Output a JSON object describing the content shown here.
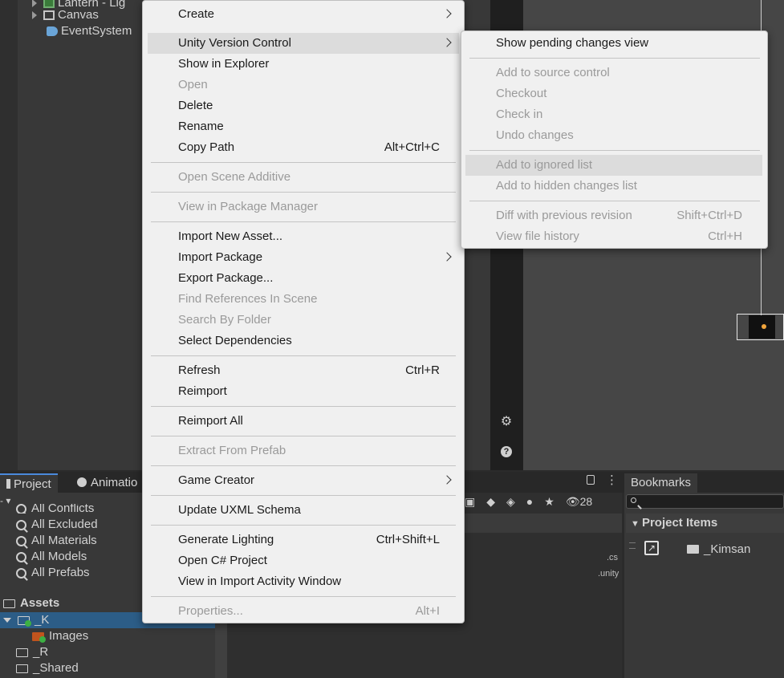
{
  "hierarchy": {
    "items": [
      {
        "label": "Lantern - Lig",
        "expandable": true
      },
      {
        "label": "Canvas",
        "expandable": true
      },
      {
        "label": "EventSystem",
        "expandable": false
      }
    ]
  },
  "context_menu": {
    "items": [
      {
        "label": "Create",
        "submenu": true
      },
      {
        "label": "Unity Version Control",
        "submenu": true,
        "highlighted": true
      },
      {
        "label": "Show in Explorer"
      },
      {
        "label": "Open",
        "disabled": true
      },
      {
        "label": "Delete"
      },
      {
        "label": "Rename"
      },
      {
        "label": "Copy Path",
        "shortcut": "Alt+Ctrl+C"
      },
      {
        "label": "Open Scene Additive",
        "disabled": true
      },
      {
        "label": "View in Package Manager",
        "disabled": true
      },
      {
        "label": "Import New Asset..."
      },
      {
        "label": "Import Package",
        "submenu": true
      },
      {
        "label": "Export Package..."
      },
      {
        "label": "Find References In Scene",
        "disabled": true
      },
      {
        "label": "Search By Folder",
        "disabled": true
      },
      {
        "label": "Select Dependencies"
      },
      {
        "label": "Refresh",
        "shortcut": "Ctrl+R"
      },
      {
        "label": "Reimport"
      },
      {
        "label": "Reimport All"
      },
      {
        "label": "Extract From Prefab",
        "disabled": true
      },
      {
        "label": "Game Creator",
        "submenu": true
      },
      {
        "label": "Update UXML Schema"
      },
      {
        "label": "Generate Lighting",
        "shortcut": "Ctrl+Shift+L"
      },
      {
        "label": "Open C# Project"
      },
      {
        "label": "View in Import Activity Window"
      },
      {
        "label": "Properties...",
        "shortcut": "Alt+I",
        "disabled": true
      }
    ]
  },
  "vcs_submenu": {
    "items": [
      {
        "label": "Show pending changes view"
      },
      {
        "label": "Add to source control",
        "disabled": true
      },
      {
        "label": "Checkout",
        "disabled": true
      },
      {
        "label": "Check in",
        "disabled": true
      },
      {
        "label": "Undo changes",
        "disabled": true
      },
      {
        "label": "Add to ignored list",
        "disabled": true,
        "highlighted": true
      },
      {
        "label": "Add to hidden changes list",
        "disabled": true
      },
      {
        "label": "Diff with previous revision",
        "shortcut": "Shift+Ctrl+D",
        "disabled": true
      },
      {
        "label": "View file history",
        "shortcut": "Ctrl+H",
        "disabled": true
      }
    ]
  },
  "bottom_tabs": {
    "project": "Project",
    "animation": "Animatio",
    "bookmarks": "Bookmarks"
  },
  "favorites": {
    "partial": "All Conflicts",
    "items": [
      "All Excluded",
      "All Materials",
      "All Models",
      "All Prefabs"
    ]
  },
  "assets": {
    "root": "Assets",
    "items": [
      "_K",
      "Images",
      "_R",
      "_Shared"
    ]
  },
  "project_toolbar": {
    "hidden_count": "28"
  },
  "file_ext": {
    "cs": ".cs",
    "unity": ".unity"
  },
  "bookmarks": {
    "section": "Project Items",
    "item": "_Kimsan"
  },
  "colors": {
    "menu_bg": "#f0f0f0",
    "menu_highlight": "#dcdcdc",
    "disabled_text": "#9a9a9a",
    "selection": "#2c5d87",
    "editor_bg": "#383838"
  }
}
